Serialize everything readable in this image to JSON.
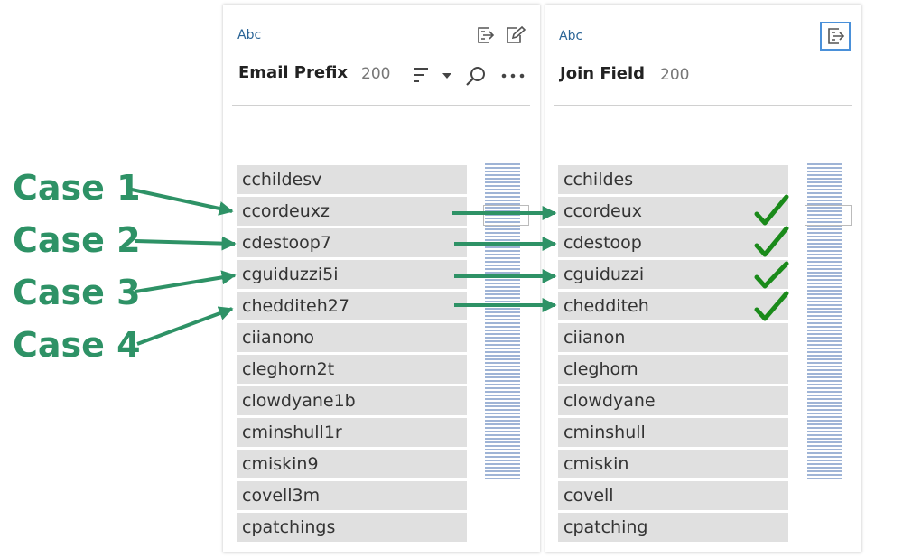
{
  "left_panel": {
    "type_label": "Abc",
    "title": "Email Prefix",
    "count": "200",
    "values": [
      "cchildesv",
      "ccordeuxz",
      "cdestoop7",
      "cguiduzzi5i",
      "chedditeh27",
      "ciianono",
      "cleghorn2t",
      "clowdyane1b",
      "cminshull1r",
      "cmiskin9",
      "covell3m",
      "cpatchings"
    ]
  },
  "right_panel": {
    "type_label": "Abc",
    "title": "Join Field",
    "count": "200",
    "values": [
      "cchildes",
      "ccordeux",
      "cdestoop",
      "cguiduzzi",
      "chedditeh",
      "ciianon",
      "cleghorn",
      "clowdyane",
      "cminshull",
      "cmiskin",
      "covell",
      "cpatching"
    ]
  },
  "annotations": {
    "cases": [
      "Case 1",
      "Case 2",
      "Case 3",
      "Case 4"
    ],
    "color": "#2e9266",
    "check_color": "#1a8a1a"
  }
}
